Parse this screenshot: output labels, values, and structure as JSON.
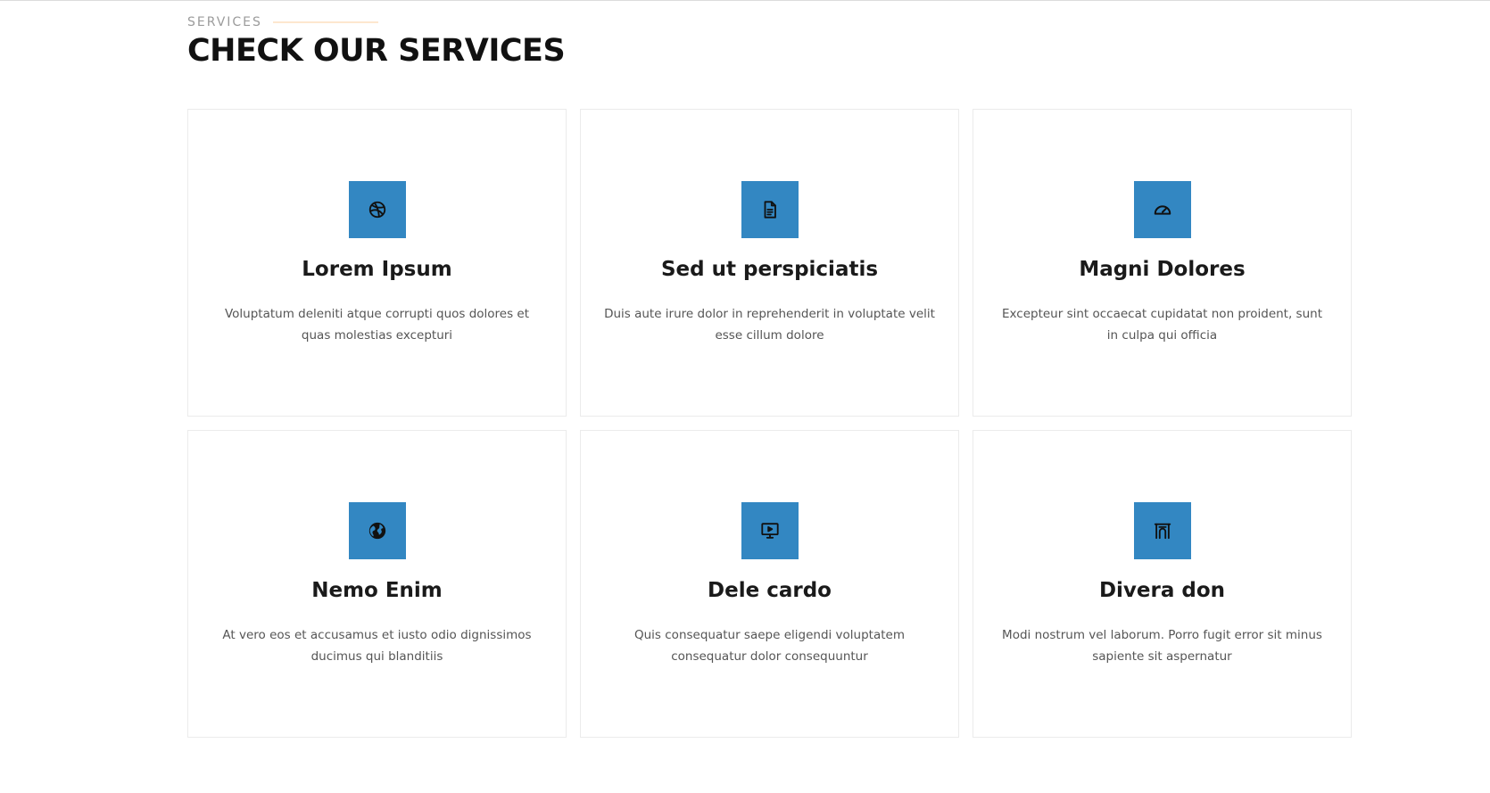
{
  "header": {
    "eyebrow": "SERVICES",
    "title": "CHECK OUR SERVICES"
  },
  "colors": {
    "accent": "#3387c2",
    "eyebrow_line": "#fde7cf",
    "card_border": "#ebebeb"
  },
  "services": [
    {
      "icon": "dribbble-icon",
      "title": "Lorem Ipsum",
      "description": "Voluptatum deleniti atque corrupti quos dolores et quas molestias excepturi"
    },
    {
      "icon": "file-text-icon",
      "title": "Sed ut perspiciatis",
      "description": "Duis aute irure dolor in reprehenderit in voluptate velit esse cillum dolore"
    },
    {
      "icon": "speedometer-icon",
      "title": "Magni Dolores",
      "description": "Excepteur sint occaecat cupidatat non proident, sunt in culpa qui officia"
    },
    {
      "icon": "globe-icon",
      "title": "Nemo Enim",
      "description": "At vero eos et accusamus et iusto odio dignissimos ducimus qui blanditiis"
    },
    {
      "icon": "presentation-icon",
      "title": "Dele cardo",
      "description": "Quis consequatur saepe eligendi voluptatem consequatur dolor consequuntur"
    },
    {
      "icon": "building-icon",
      "title": "Divera don",
      "description": "Modi nostrum vel laborum. Porro fugit error sit minus sapiente sit aspernatur"
    }
  ]
}
